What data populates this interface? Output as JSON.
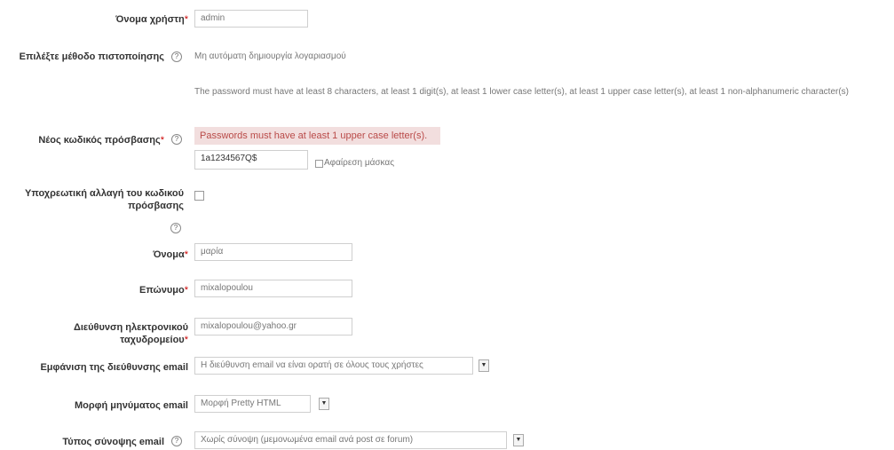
{
  "form": {
    "username": {
      "label": "Όνομα χρήστη",
      "required_mark": "*",
      "value": "admin"
    },
    "auth": {
      "label": "Επιλέξτε μέθοδο πιστοποίησης",
      "value": "Μη αυτόματη δημιουργία λογαριασμού"
    },
    "password_policy": "The password must have at least 8 characters, at least 1 digit(s), at least 1 lower case letter(s), at least 1 upper case letter(s), at least 1 non-alphanumeric character(s)",
    "new_password": {
      "label": "Νέος κωδικός πρόσβασης",
      "required_mark": "*",
      "error": "Passwords must have at least 1 upper case letter(s).",
      "value": "1a1234567Q$",
      "unmask_label": "Αφαίρεση μάσκας"
    },
    "force_change": {
      "label_line1": "Υποχρεωτική αλλαγή του κωδικού",
      "label_line2": "πρόσβασης"
    },
    "firstname": {
      "label": "Όνομα",
      "required_mark": "*",
      "value": "μαρία"
    },
    "lastname": {
      "label": "Επώνυμο",
      "required_mark": "*",
      "value": "mixalopoulou"
    },
    "email": {
      "label_line1": "Διεύθυνση ηλεκτρονικού",
      "label_line2": "ταχυδρομείου",
      "required_mark": "*",
      "value": "mixalopoulou@yahoo.gr"
    },
    "maildisplay": {
      "label": "Εμφάνιση της διεύθυνσης email",
      "value": "Η διεύθυνση email να είναι ορατή σε όλους τους χρήστες"
    },
    "mailformat": {
      "label": "Μορφή μηνύματος email",
      "value": "Μορφή Pretty HTML"
    },
    "maildigest": {
      "label": "Τύπος σύνοψης email",
      "value": "Χωρίς σύνοψη (μεμονωμένα email ανά post σε forum)"
    }
  },
  "icons": {
    "help": "help-icon",
    "dropdown": "dropdown-arrow-icon"
  },
  "colors": {
    "error_bg": "#f2dede",
    "error_text": "#b94a48",
    "required": "#cc0000"
  }
}
